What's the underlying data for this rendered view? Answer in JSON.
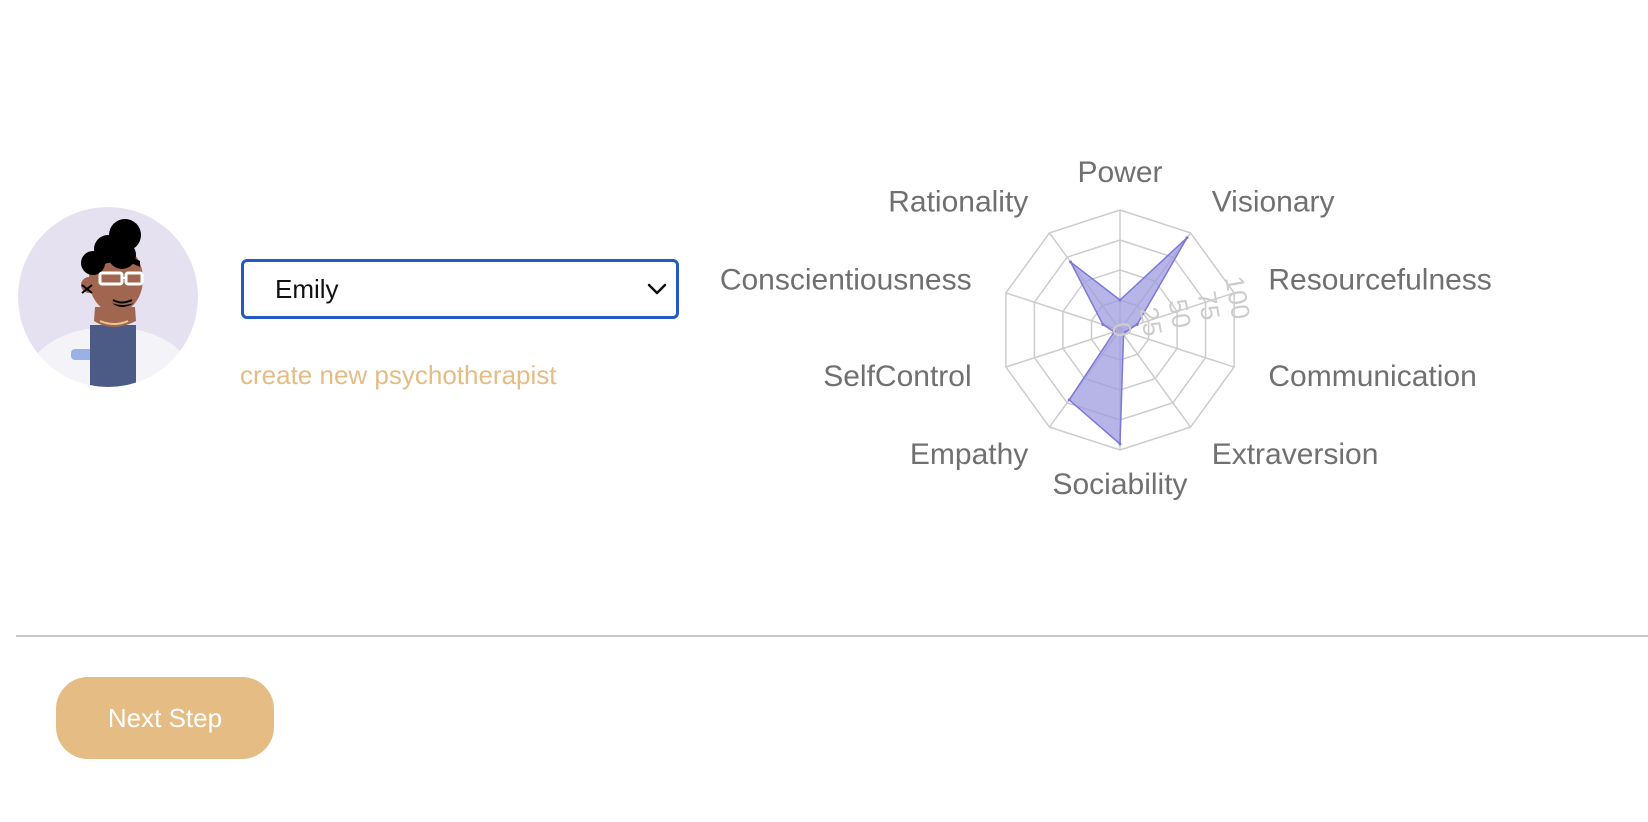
{
  "therapist": {
    "selected": "Emily",
    "create_link": "create new psychotherapist"
  },
  "chart_data": {
    "type": "radar",
    "axes": [
      "Power",
      "Visionary",
      "Resourcefulness",
      "Communication",
      "Extraversion",
      "Sociability",
      "Empathy",
      "SelfControl",
      "Conscientiousness",
      "Rationality"
    ],
    "values": [
      25,
      95,
      15,
      5,
      5,
      95,
      72,
      5,
      15,
      70
    ],
    "range": [
      0,
      100
    ],
    "ticks": [
      0,
      25,
      50,
      75,
      100
    ],
    "fill_color": "#9f9be0",
    "stroke_color": "#7d78d6",
    "grid_color": "#cccccc"
  },
  "footer": {
    "next_label": "Next Step"
  },
  "colors": {
    "accent": "#e5bc84",
    "select_border": "#2458c4"
  }
}
